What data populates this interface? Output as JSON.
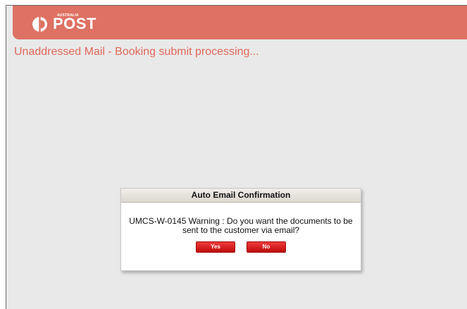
{
  "brand": {
    "logo_small": "AUSTRALIA",
    "logo_big": "POST",
    "header_color": "#de7163"
  },
  "page": {
    "title": "Unaddressed Mail - Booking submit processing..."
  },
  "dialog": {
    "title": "Auto Email Confirmation",
    "message_line1": "UMCS-W-0145 Warning : Do you want the documents to be",
    "message_line2": "sent to the customer via email?",
    "yes_label": "Yes",
    "no_label": "No"
  }
}
